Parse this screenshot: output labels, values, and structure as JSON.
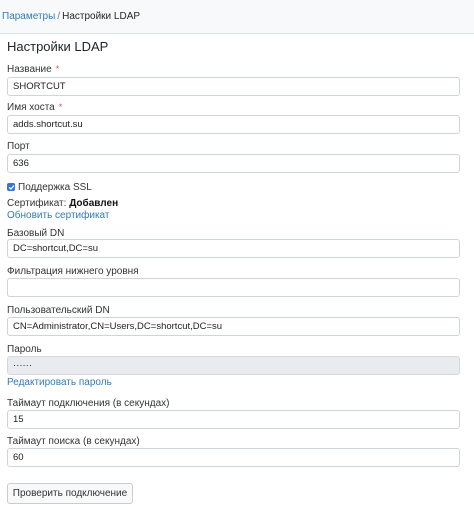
{
  "breadcrumb": {
    "parent": "Параметры",
    "separator": "/",
    "current": "Настройки LDAP"
  },
  "form": {
    "title": "Настройки LDAP",
    "name": {
      "label": "Название",
      "required": "*",
      "value": "SHORTCUT"
    },
    "host": {
      "label": "Имя хоста",
      "required": "*",
      "value": "adds.shortcut.su"
    },
    "port": {
      "label": "Порт",
      "value": "636"
    },
    "ssl": {
      "label": "Поддержка SSL",
      "checked": true
    },
    "certificate": {
      "label": "Сертификат:",
      "status": "Добавлен",
      "update_link": "Обновить сертификат"
    },
    "base_dn": {
      "label": "Базовый DN",
      "value": "DC=shortcut,DC=su"
    },
    "filter": {
      "label": "Фильтрация нижнего уровня",
      "value": ""
    },
    "user_dn": {
      "label": "Пользовательский DN",
      "value": "CN=Administrator,CN=Users,DC=shortcut,DC=su"
    },
    "password": {
      "label": "Пароль",
      "value": "······",
      "edit_link": "Редактировать пароль"
    },
    "connect_timeout": {
      "label": "Таймаут подключения (в секундах)",
      "value": "15"
    },
    "search_timeout": {
      "label": "Таймаут поиска (в секундах)",
      "value": "60"
    },
    "test_button": "Проверить подключение"
  },
  "colors": {
    "link": "#337ab7",
    "required": "#d9534f",
    "checkbox": "#3273dc"
  }
}
